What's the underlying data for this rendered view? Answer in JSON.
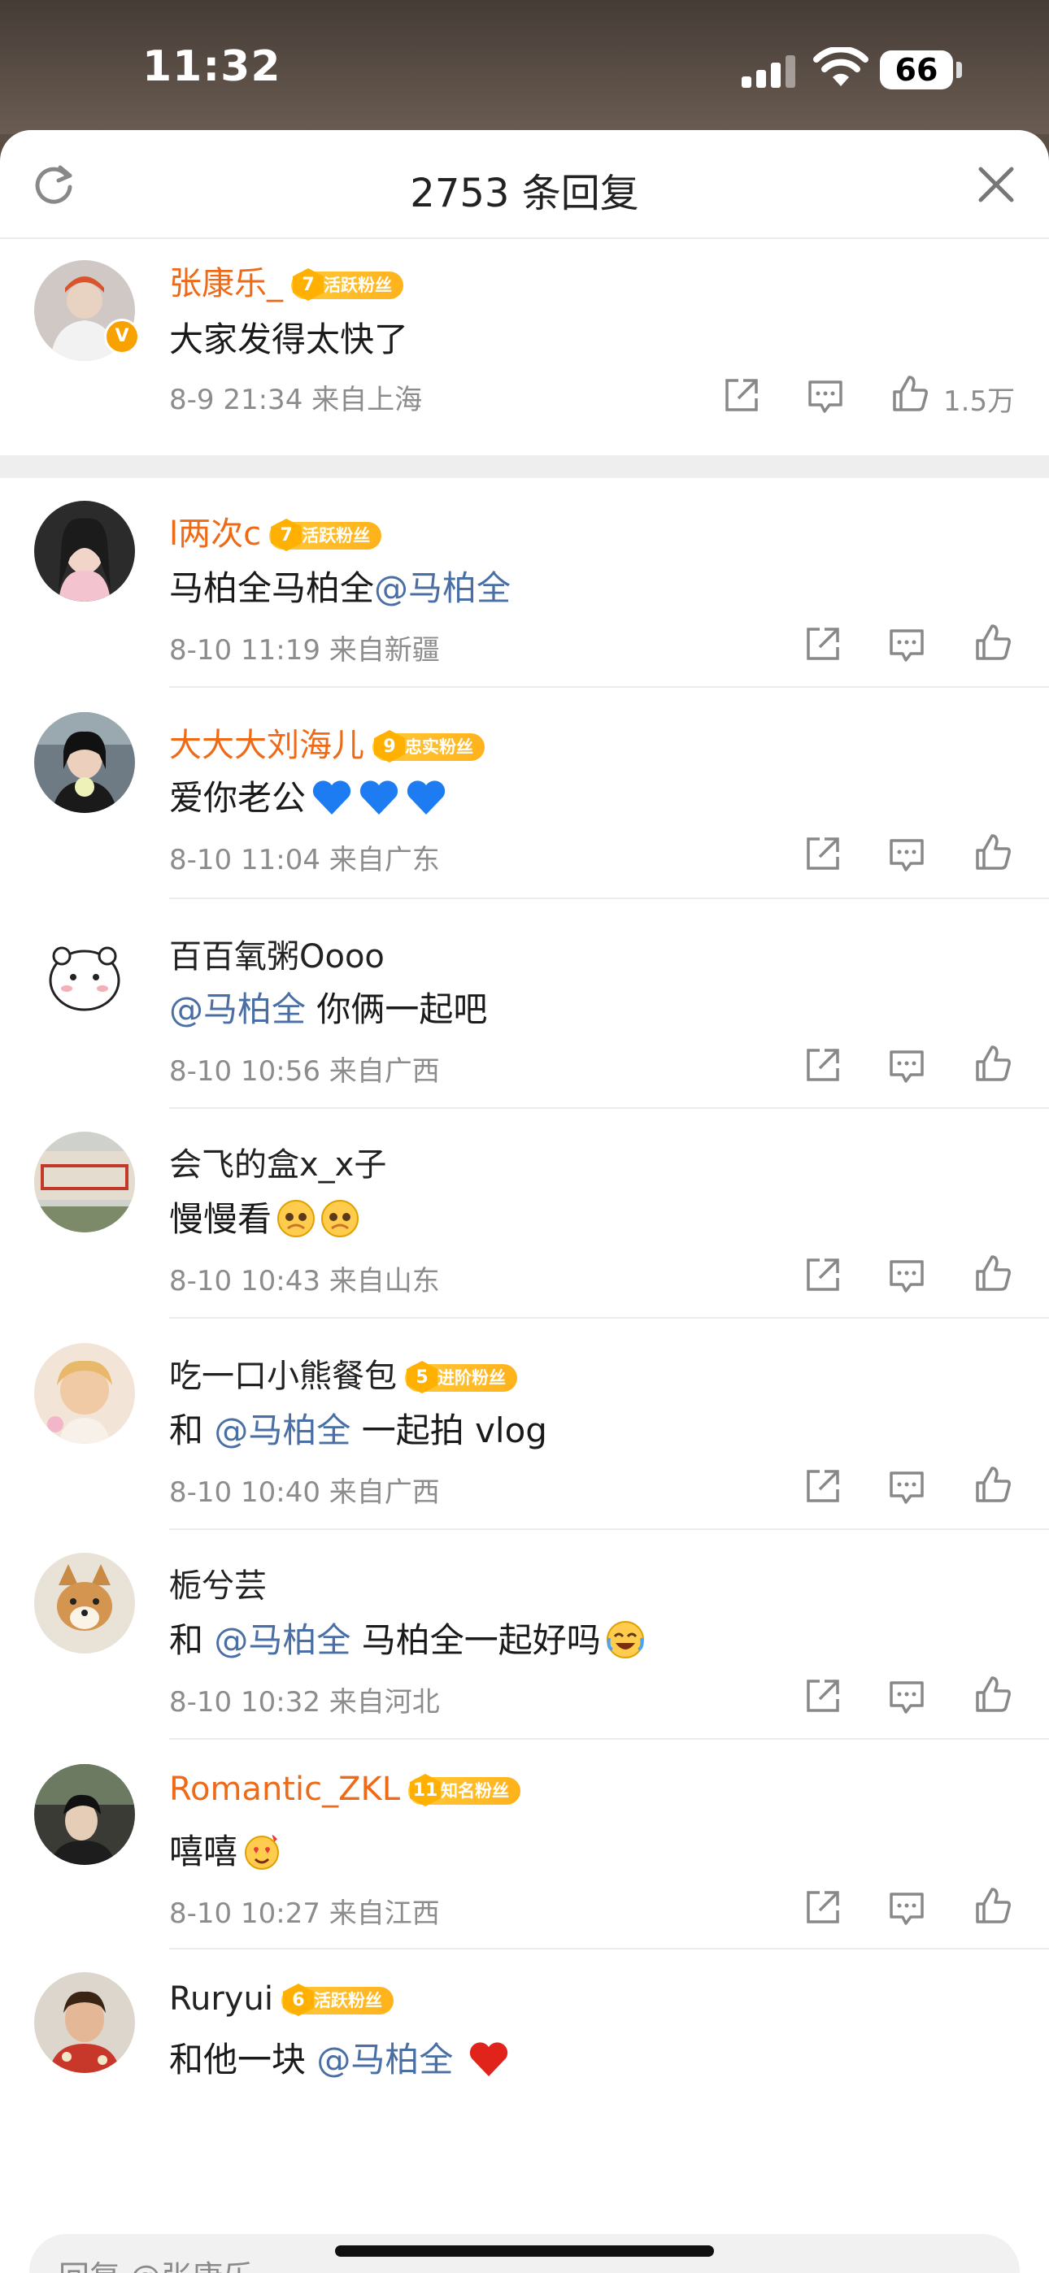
{
  "status_bar": {
    "time": "11:32",
    "battery": "66"
  },
  "header": {
    "title": "2753 条回复"
  },
  "top_comment": {
    "username": "张康乐_",
    "fan_level": "7",
    "fan_badge": "活跃粉丝",
    "text": "大家发得太快了",
    "meta": "8-9 21:34  来自上海",
    "likes": "1.5万"
  },
  "replies": [
    {
      "username": "l两次c",
      "fan_level": "7",
      "fan_badge": "活跃粉丝",
      "text_before": "马柏全马柏全",
      "mention": "@马柏全",
      "text_after": "",
      "meta": "8-10 11:19  来自新疆"
    },
    {
      "username": "大大大刘海儿",
      "fan_level": "9",
      "fan_badge": "忠实粉丝",
      "text_before": "爱你老公",
      "mention": "",
      "text_after": "",
      "meta": "8-10 11:04  来自广东"
    },
    {
      "username": "百百氧粥Oooo",
      "fan_level": "",
      "fan_badge": "",
      "text_before": "",
      "mention": "@马柏全",
      "text_after": " 你俩一起吧",
      "meta": "8-10 10:56  来自广西"
    },
    {
      "username": "会飞的盒x_x子",
      "fan_level": "",
      "fan_badge": "",
      "text_before": "慢慢看",
      "mention": "",
      "text_after": "",
      "meta": "8-10 10:43  来自山东"
    },
    {
      "username": "吃一口小熊餐包",
      "fan_level": "5",
      "fan_badge": "进阶粉丝",
      "text_before": "和 ",
      "mention": "@马柏全",
      "text_after": " 一起拍 vlog",
      "meta": "8-10 10:40  来自广西"
    },
    {
      "username": "栀兮芸",
      "fan_level": "",
      "fan_badge": "",
      "text_before": "和 ",
      "mention": "@马柏全",
      "text_after": " 马柏全一起好吗",
      "meta": "8-10 10:32  来自河北"
    },
    {
      "username": "Romantic_ZKL",
      "fan_level": "11",
      "fan_badge": "知名粉丝",
      "text_before": "嘻嘻",
      "mention": "",
      "text_after": "",
      "meta": "8-10 10:27  来自江西"
    },
    {
      "username": "Ruryui",
      "fan_level": "6",
      "fan_badge": "活跃粉丝",
      "text_before": "和他一块 ",
      "mention": "@马柏全",
      "text_after": "",
      "meta": ""
    }
  ],
  "reply_input": {
    "placeholder": "回复 @张康乐_"
  },
  "colors": {
    "username_orange": "#ee6a17",
    "mention_blue": "#4a6fa5",
    "badge_gold": "#ffb21a"
  }
}
